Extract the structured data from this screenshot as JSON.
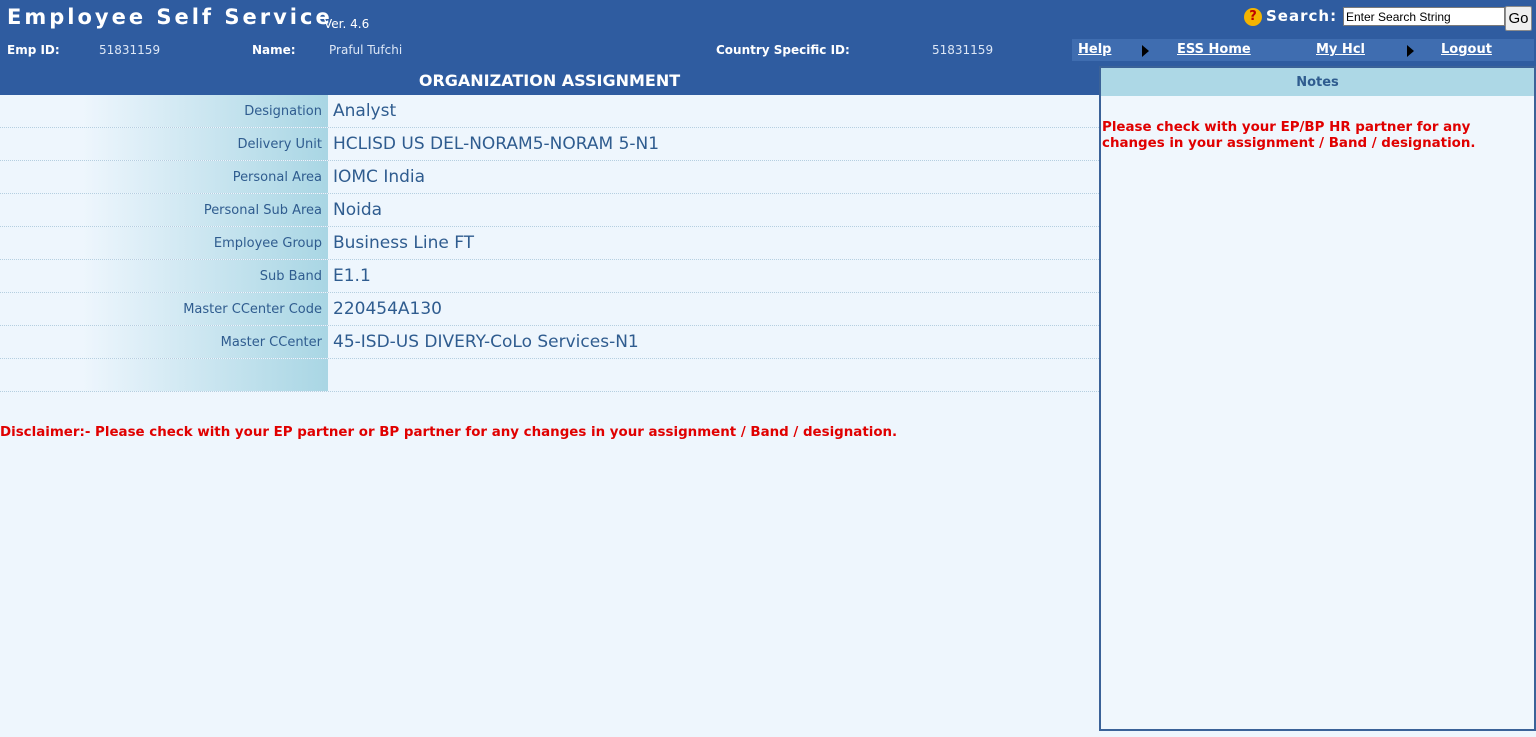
{
  "header": {
    "app_title": "Employee Self Service",
    "version": "Ver. 4.6",
    "search_label": "Search:",
    "search_value": "Enter Search String",
    "go_label": "Go",
    "help_icon": "?"
  },
  "employee": {
    "emp_id_label": "Emp ID:",
    "emp_id": "51831159",
    "name_label": "Name:",
    "name": "Praful Tufchi",
    "country_id_label": "Country Specific ID:",
    "country_id": "51831159"
  },
  "nav": {
    "help": "Help",
    "ess_home": "ESS Home",
    "my_hcl": "My Hcl",
    "logout": "Logout"
  },
  "page_title": "ORGANIZATION ASSIGNMENT",
  "fields": [
    {
      "label": "Designation",
      "value": "Analyst"
    },
    {
      "label": "Delivery Unit",
      "value": "HCLISD US DEL-NORAM5-NORAM 5-N1"
    },
    {
      "label": "Personal Area",
      "value": "IOMC India"
    },
    {
      "label": "Personal Sub Area",
      "value": "Noida"
    },
    {
      "label": "Employee Group",
      "value": "Business Line FT"
    },
    {
      "label": "Sub Band",
      "value": "E1.1"
    },
    {
      "label": "Master CCenter Code",
      "value": "220454A130"
    },
    {
      "label": "Master CCenter",
      "value": "45-ISD-US DIVERY-CoLo Services-N1"
    }
  ],
  "disclaimer": "Disclaimer:- Please check with your EP partner or BP partner for any changes in your assignment / Band / designation.",
  "notes": {
    "title": "Notes",
    "text": "Please check with your EP/BP HR partner for any changes in your assignment / Band / designation."
  },
  "colors": {
    "header_bg": "#2f5ca0",
    "page_bg": "#eef6fd",
    "label_text": "#2f5c8f",
    "warning_text": "#e00000",
    "notes_header_bg": "#add8e6"
  }
}
